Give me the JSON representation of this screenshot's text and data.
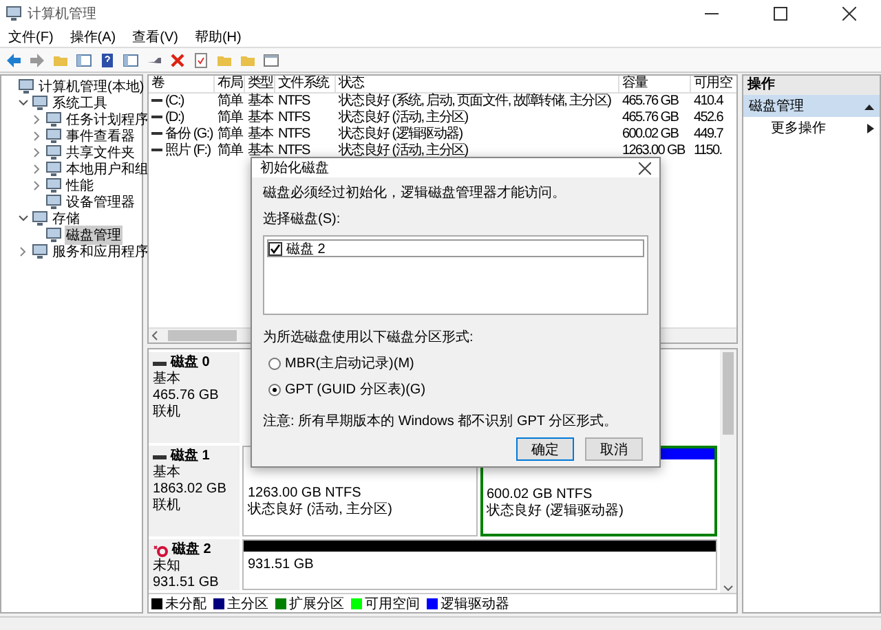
{
  "window": {
    "title": "计算机管理"
  },
  "menu": [
    "文件(F)",
    "操作(A)",
    "查看(V)",
    "帮助(H)"
  ],
  "tree": [
    {
      "label": "计算机管理(本地)",
      "selected": false,
      "children": [
        {
          "label": "系统工具",
          "expanded": true,
          "selected": false,
          "children": [
            {
              "label": "任务计划程序",
              "expanded": false,
              "selected": false
            },
            {
              "label": "事件查看器",
              "expanded": false,
              "selected": false
            },
            {
              "label": "共享文件夹",
              "expanded": false,
              "selected": false
            },
            {
              "label": "本地用户和组",
              "expanded": false,
              "selected": false
            },
            {
              "label": "性能",
              "expanded": false,
              "selected": false
            },
            {
              "label": "设备管理器",
              "selected": false
            }
          ]
        },
        {
          "label": "存储",
          "expanded": true,
          "selected": false,
          "children": [
            {
              "label": "磁盘管理",
              "selected": true
            }
          ]
        },
        {
          "label": "服务和应用程序",
          "expanded": false,
          "selected": false
        }
      ]
    }
  ],
  "table": {
    "columns": [
      "卷",
      "布局",
      "类型",
      "文件系统",
      "状态",
      "容量",
      "可用空"
    ],
    "rows": [
      [
        "(C:)",
        "简单",
        "基本",
        "NTFS",
        "状态良好 (系统, 启动, 页面文件, 故障转储, 主分区)",
        "465.76 GB",
        "410.4"
      ],
      [
        "(D:)",
        "简单",
        "基本",
        "NTFS",
        "状态良好 (活动, 主分区)",
        "465.76 GB",
        "452.6"
      ],
      [
        "备份 (G:)",
        "简单",
        "基本",
        "NTFS",
        "状态良好 (逻辑驱动器)",
        "600.02 GB",
        "449.7"
      ],
      [
        "照片 (F:)",
        "简单",
        "基本",
        "NTFS",
        "状态良好 (活动, 主分区)",
        "1263.00 GB",
        "1150."
      ]
    ]
  },
  "disks": [
    {
      "name": "磁盘 0",
      "initialized": true,
      "lines": [
        "基本",
        "465.76 GB",
        "联机"
      ]
    },
    {
      "name": "磁盘 1",
      "initialized": true,
      "lines": [
        "基本",
        "1863.02 GB",
        "联机"
      ],
      "partitions": [
        {
          "extended": false,
          "lines": [
            "1263.00 GB NTFS",
            "状态良好 (活动, 主分区)"
          ]
        },
        {
          "color": "#0000ff",
          "extended": true,
          "lines": [
            "600.02 GB NTFS",
            "状态良好 (逻辑驱动器)"
          ]
        }
      ]
    },
    {
      "name": "磁盘 2",
      "initialized": false,
      "lines": [
        "未知",
        "931.51 GB"
      ],
      "partitions": [
        {
          "color": "#000000",
          "extended": false,
          "lines": [
            "931.51 GB"
          ]
        }
      ]
    }
  ],
  "legend": [
    {
      "label": "未分配",
      "color": "#000000"
    },
    {
      "label": "主分区",
      "color": "#00007f"
    },
    {
      "label": "扩展分区",
      "color": "#008000"
    },
    {
      "label": "可用空间",
      "color": "#00ff00"
    },
    {
      "label": "逻辑驱动器",
      "color": "#0000ff"
    }
  ],
  "actions": {
    "title": "操作",
    "section": {
      "label": "磁盘管理",
      "expanded": true
    },
    "items": [
      "更多操作"
    ]
  },
  "dialog": {
    "title": "初始化磁盘",
    "message": "磁盘必须经过初始化，逻辑磁盘管理器才能访问。",
    "list_label": "选择磁盘(S):",
    "disks": [
      {
        "label": "磁盘 2",
        "checked": true
      }
    ],
    "style_label": "为所选磁盘使用以下磁盘分区形式:",
    "options": [
      {
        "label": "MBR(主启动记录)(M)",
        "selected": false
      },
      {
        "label": "GPT (GUID 分区表)(G)",
        "selected": true
      }
    ],
    "note": "注意: 所有早期版本的 Windows 都不识别 GPT 分区形式。",
    "buttons": [
      {
        "label": "确定",
        "default": true
      },
      {
        "label": "取消",
        "default": false
      }
    ]
  }
}
